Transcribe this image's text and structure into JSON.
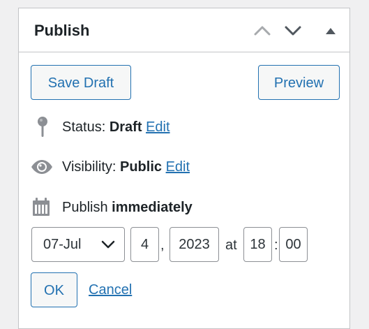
{
  "panel": {
    "title": "Publish",
    "move_up_label": "Move up",
    "move_down_label": "Move down",
    "toggle_label": "Toggle panel"
  },
  "actions": {
    "save_draft": "Save Draft",
    "preview": "Preview"
  },
  "status": {
    "label": "Status:",
    "value": "Draft",
    "edit": "Edit"
  },
  "visibility": {
    "label": "Visibility:",
    "value": "Public",
    "edit": "Edit"
  },
  "publish": {
    "label": "Publish",
    "value": "immediately"
  },
  "date": {
    "month": "07-Jul",
    "day": "4",
    "comma": ",",
    "year": "2023",
    "at": "at",
    "hour": "18",
    "colon": ":",
    "minute": "00"
  },
  "date_actions": {
    "ok": "OK",
    "cancel": "Cancel"
  },
  "icons": {
    "status": "pin-icon",
    "visibility": "eye-icon",
    "schedule": "calendar-icon"
  },
  "colors": {
    "accent": "#2271b1",
    "border": "#c3c4c7",
    "text": "#1d2327",
    "icon": "#8c8f94"
  }
}
